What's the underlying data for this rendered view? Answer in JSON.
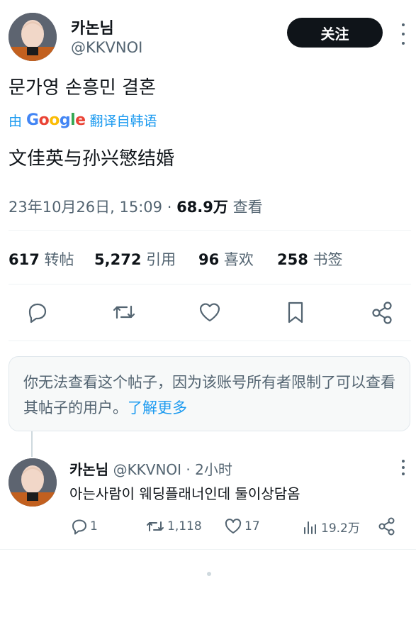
{
  "tweet": {
    "author_name": "카논님",
    "author_handle": "@KKVNOI",
    "follow_label": "关注",
    "text": "문가영 손흥민 결혼",
    "translate": {
      "prefix": "由",
      "brand": "Google",
      "suffix": "翻译自韩语"
    },
    "translated_text": "文佳英与孙兴慜结婚",
    "timestamp": "23年10月26日, 15:09 · ",
    "views_count": "68.9万",
    "views_label": " 查看"
  },
  "stats": [
    {
      "count": "617",
      "label": "转帖"
    },
    {
      "count": "5,272",
      "label": "引用"
    },
    {
      "count": "96",
      "label": "喜欢"
    },
    {
      "count": "258",
      "label": "书签"
    }
  ],
  "notice": {
    "text": "你无法查看这个帖子，因为该账号所有者限制了可以查看其帖子的用户。",
    "link": "了解更多"
  },
  "reply": {
    "author_name": "카논님",
    "meta": "@KKVNOI · 2小时",
    "text": "아는사람이 웨딩플래너인데 둘이상담옴",
    "replies": "1",
    "retweets": "1,118",
    "likes": "17",
    "views": "19.2万"
  },
  "icons": {
    "reply": "reply-icon",
    "retweet": "retweet-icon",
    "like": "heart-icon",
    "bookmark": "bookmark-icon",
    "share": "share-icon",
    "views": "views-icon"
  },
  "colors": {
    "accent": "#1d9bf0",
    "text": "#0f1419",
    "secondary": "#536471",
    "follow_bg": "#0f1419"
  }
}
